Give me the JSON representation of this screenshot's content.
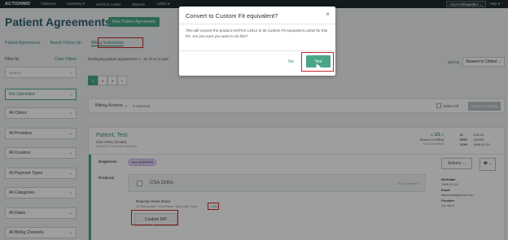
{
  "topnav": {
    "logo": "ACTIONMD",
    "items": [
      "Clinical ▾",
      "Inventory ▾",
      "HCPCS Codes",
      "Reports",
      "Admin ▾"
    ],
    "org": "CSA Orthopedics ⌄",
    "help": "Help ▾ ⋮"
  },
  "page": {
    "title": "Patient Agreements",
    "new_button": "New Patient Agreement",
    "subnav": [
      "Patient Agreements",
      "Needs Follow Up",
      "Billing Submission"
    ]
  },
  "sidebar": {
    "filter_by": "Filter by",
    "clear": "Clear Filters",
    "search_placeholder": "Search",
    "status": "Not Submitted",
    "filters": [
      "All Clinics",
      "All Providers",
      "All Creators",
      "All Payment Types",
      "All Categories",
      "All Dates",
      "All Billing Channels"
    ]
  },
  "content": {
    "displaying": "Displaying patient agreements 1 - 10 of 11 in total",
    "sort_label": "Sort by:",
    "sort_value": "Newest to Oldest ⌄",
    "pages": [
      "1",
      "2",
      "3",
      "»"
    ],
    "billing_actions": "Billing Actions ⌄",
    "selected": "0 Selected",
    "select_all": "Select All",
    "submit": "Submit to Billing"
  },
  "patient": {
    "name": "Patient, Test",
    "clinic": "CSA Ortho (South)",
    "meta": "08/24/2022 by Andrew DiBeano",
    "ready_count": "1/1",
    "ready": "Ready for Billing",
    "not_submitted": "Not Submitted",
    "ids": [
      {
        "k": "ID",
        "v": "114210"
      },
      {
        "k": "MRN",
        "v": "115485"
      },
      {
        "k": "DOB",
        "v": "1966-01-05"
      }
    ],
    "diagnoses_label": "Diagnoses",
    "diagnosis_tag": "See EMR/PM",
    "products_label": "Products",
    "group_name": "CSA Ortho",
    "group_status": "Not Submitted",
    "product_name": "Reaction Knee Brace",
    "product_meta": "DJ Orthopedics · Knee Brace · Body Side: Right ·",
    "product_code": "L1812",
    "custom_fit_button": "Custom Fit?",
    "actions_button": "Actions ⌄",
    "print_button": "🖶 ⌄",
    "info": [
      {
        "k": "Birthdate",
        "v": "1966-01-05"
      },
      {
        "k": "Email",
        "v": "fakeemail@gmail.com"
      },
      {
        "k": "Provider",
        "v": "Joe Bent"
      }
    ]
  },
  "modal": {
    "title": "Convert to Custom Fit equivalent?",
    "close": "×",
    "body": "This will convert the product HCPCS L1812 to its Custom Fit equivalent L1810 for this PA. Are you sure you want to do this?",
    "no": "No",
    "yes": "Yes"
  },
  "colors": {
    "accent": "#4aa687",
    "highlight": "#c62828",
    "navbar": "#1f2a30"
  }
}
